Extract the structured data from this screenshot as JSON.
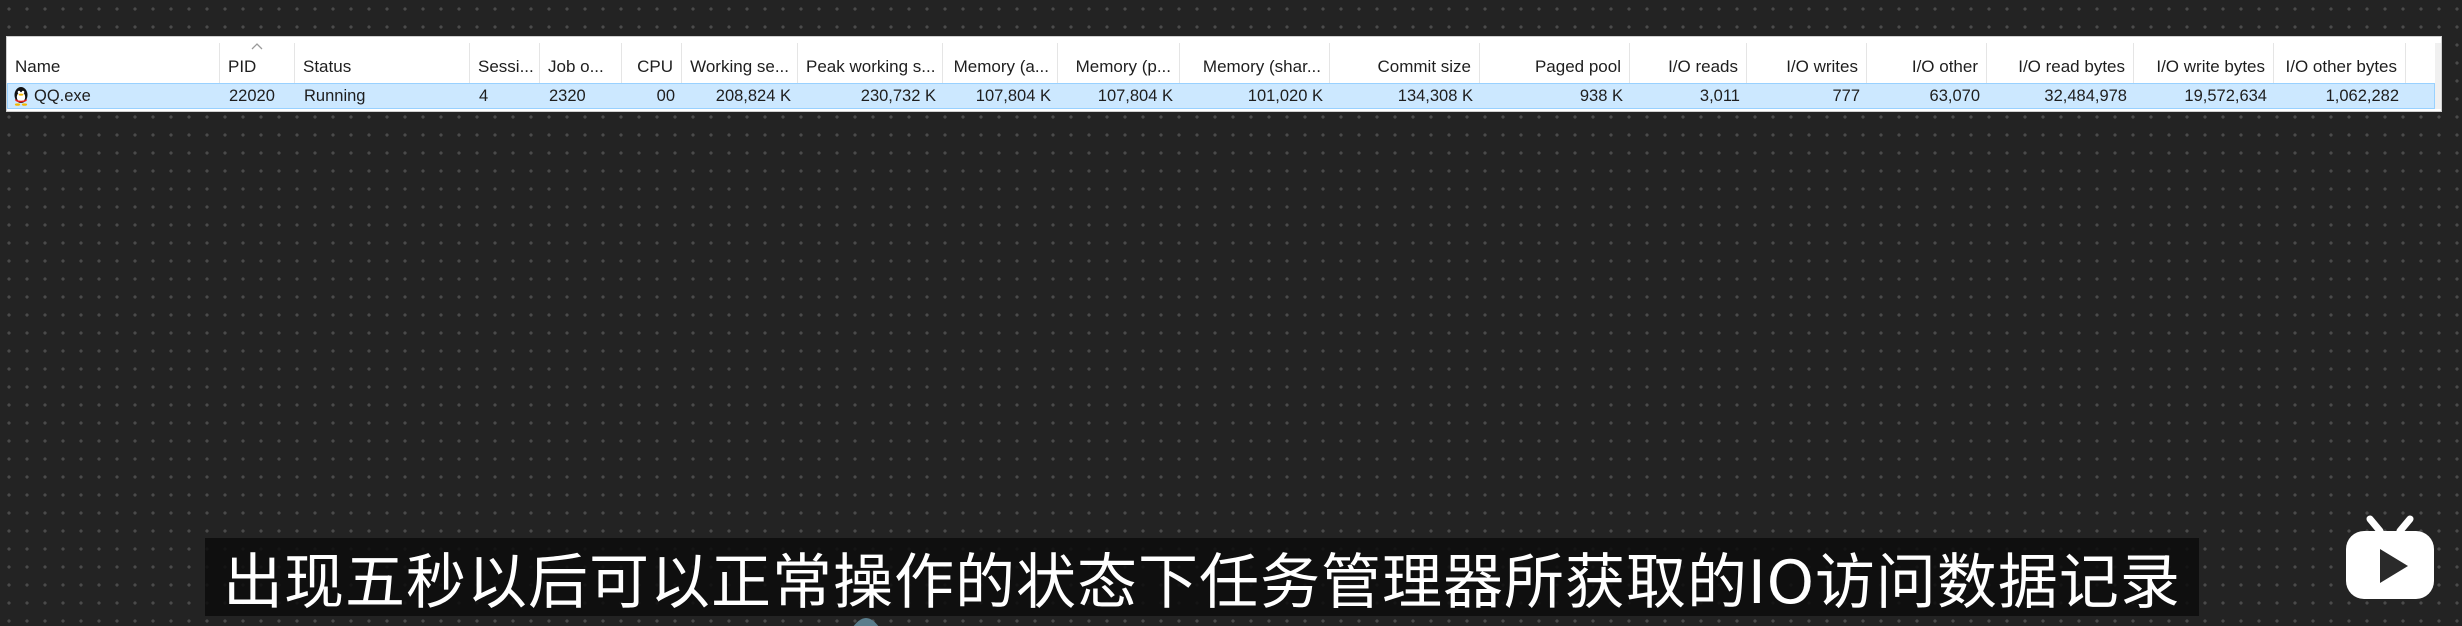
{
  "table": {
    "columns": [
      {
        "key": "name",
        "label": "Name",
        "align": "left"
      },
      {
        "key": "pid",
        "label": "PID",
        "align": "left",
        "sorted": true
      },
      {
        "key": "status",
        "label": "Status",
        "align": "left"
      },
      {
        "key": "session",
        "label": "Sessi...",
        "align": "left"
      },
      {
        "key": "job",
        "label": "Job o...",
        "align": "left"
      },
      {
        "key": "cpu",
        "label": "CPU",
        "align": "right"
      },
      {
        "key": "working_set",
        "label": "Working se...",
        "align": "right"
      },
      {
        "key": "peak_working_set",
        "label": "Peak working s...",
        "align": "right"
      },
      {
        "key": "memory_active",
        "label": "Memory (a...",
        "align": "right"
      },
      {
        "key": "memory_private",
        "label": "Memory (p...",
        "align": "right"
      },
      {
        "key": "memory_shared",
        "label": "Memory (shar...",
        "align": "right"
      },
      {
        "key": "commit_size",
        "label": "Commit size",
        "align": "right"
      },
      {
        "key": "paged_pool",
        "label": "Paged pool",
        "align": "right"
      },
      {
        "key": "io_reads",
        "label": "I/O reads",
        "align": "right"
      },
      {
        "key": "io_writes",
        "label": "I/O writes",
        "align": "right"
      },
      {
        "key": "io_other",
        "label": "I/O other",
        "align": "right"
      },
      {
        "key": "io_read_bytes",
        "label": "I/O read bytes",
        "align": "right"
      },
      {
        "key": "io_write_bytes",
        "label": "I/O write bytes",
        "align": "right"
      },
      {
        "key": "io_other_bytes",
        "label": "I/O other bytes",
        "align": "right"
      }
    ],
    "rows": [
      {
        "name": "QQ.exe",
        "icon": "qq-penguin-icon",
        "selected": true,
        "pid": "22020",
        "status": "Running",
        "session": "4",
        "job": "2320",
        "cpu": "00",
        "working_set": "208,824 K",
        "peak_working_set": "230,732 K",
        "memory_active": "107,804 K",
        "memory_private": "107,804 K",
        "memory_shared": "101,020 K",
        "commit_size": "134,308 K",
        "paged_pool": "938 K",
        "io_reads": "3,011",
        "io_writes": "777",
        "io_other": "63,070",
        "io_read_bytes": "32,484,978",
        "io_write_bytes": "19,572,634",
        "io_other_bytes": "1,062,282"
      }
    ]
  },
  "subtitle": "出现五秒以后可以正常操作的状态下任务管理器所获取的IO访问数据记录",
  "colors": {
    "selection_bg": "#cce8ff",
    "selection_border": "#99d1ff",
    "background": "#232323",
    "logo": "#ffffff"
  },
  "watermark": {
    "icon": "bilibili-tv-logo-icon"
  }
}
